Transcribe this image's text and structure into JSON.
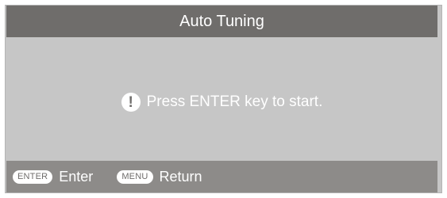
{
  "title_bar": {
    "title": "Auto Tuning"
  },
  "content": {
    "message": "Press ENTER key to start.",
    "icon": "exclamation-icon"
  },
  "footer": {
    "hints": [
      {
        "key": "ENTER",
        "label": "Enter"
      },
      {
        "key": "MENU",
        "label": "Return"
      }
    ]
  },
  "colors": {
    "title_bar_bg": "#6f6d6b",
    "content_bg": "#c6c6c6",
    "footer_bg": "#8d8b89",
    "text": "#ffffff"
  }
}
